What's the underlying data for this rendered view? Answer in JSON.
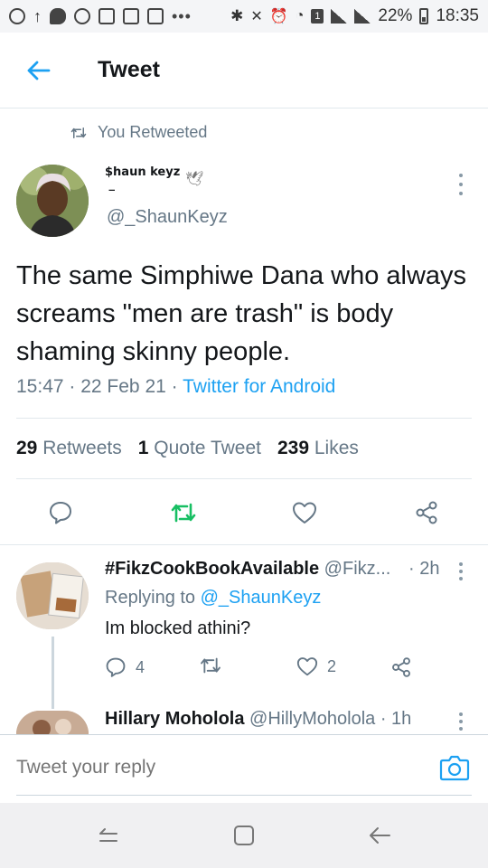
{
  "status_bar": {
    "battery": "22%",
    "time": "18:35",
    "sim_badge": "1"
  },
  "header": {
    "title": "Tweet"
  },
  "tweet": {
    "retweet_label": "You Retweeted",
    "display_name": "$haun keyz\n _",
    "handle": "@_ShaunKeyz",
    "text": "The same Simphiwe Dana who always screams \"men are trash\" is body shaming skinny people.",
    "time": "15:47",
    "date": "22 Feb 21",
    "source": "Twitter for Android",
    "retweets_count": "29",
    "retweets_label": "Retweets",
    "quotes_count": "1",
    "quotes_label": "Quote Tweet",
    "likes_count": "239",
    "likes_label": "Likes",
    "retweeted_color": "#17bf63"
  },
  "replies": [
    {
      "display_name": "#FikzCookBookAvailable",
      "handle": "@Fikz...",
      "time": "· 2h",
      "replying_prefix": "Replying to",
      "replying_to": "@_ShaunKeyz",
      "text": "Im blocked athini?",
      "reply_count": "4",
      "retweet_count": "",
      "like_count": "2"
    },
    {
      "display_name": "Hillary Moholola",
      "handle": "@HillyMoholola",
      "time": "· 1h"
    }
  ],
  "composer": {
    "placeholder": "Tweet your reply"
  },
  "colors": {
    "accent": "#1da1f2",
    "muted": "#657786",
    "text": "#14171a"
  }
}
